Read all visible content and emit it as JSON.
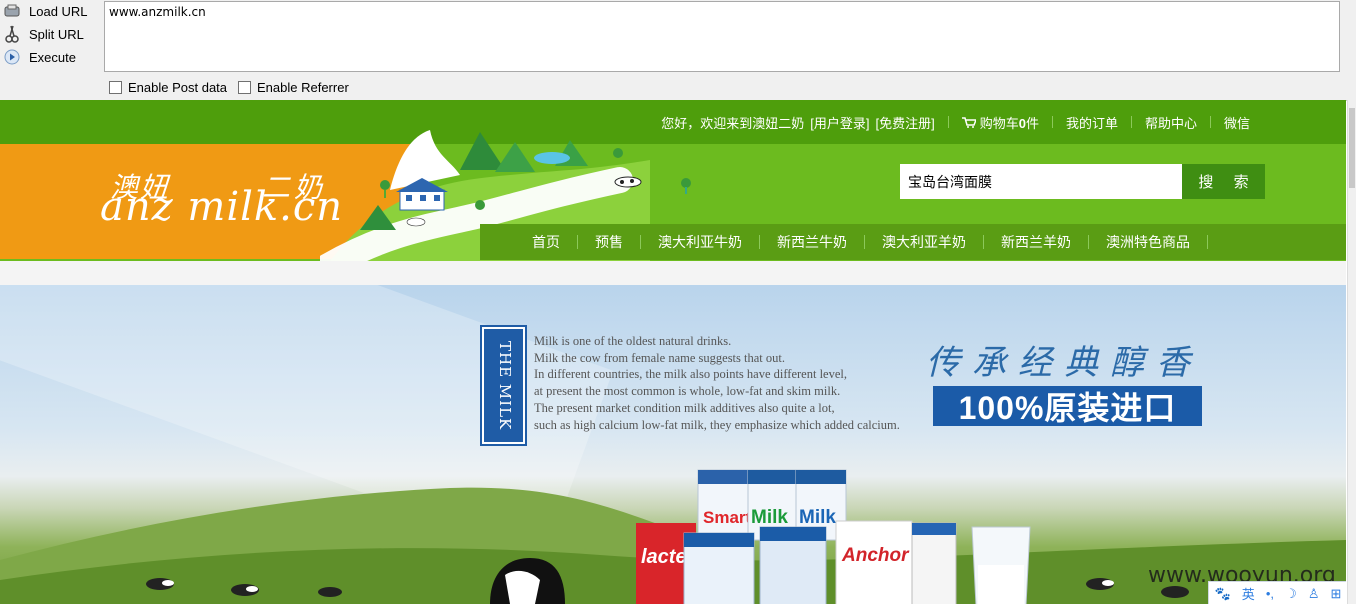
{
  "hackbar": {
    "load_url": "Load URL",
    "split_url": "Split URL",
    "execute": "Execute",
    "url_value": "www.anzmilk.cn",
    "enable_post": "Enable Post data",
    "enable_referrer": "Enable Referrer"
  },
  "site": {
    "topnav": {
      "welcome": "您好，欢迎来到澳妞二奶",
      "login": "[用户登录]",
      "register": "[免费注册]",
      "cart": "购物车",
      "cart_count": "0",
      "cart_unit": "件",
      "orders": "我的订单",
      "help": "帮助中心",
      "wechat": "微信"
    },
    "logo": {
      "cn_left": "澳妞",
      "cn_right": "二奶",
      "en": "anz milk.cn"
    },
    "search": {
      "value": "宝岛台湾面膜",
      "button": "搜 索"
    },
    "mainnav": [
      "首页",
      "预售",
      "澳大利亚牛奶",
      "新西兰牛奶",
      "澳大利亚羊奶",
      "新西兰羊奶",
      "澳洲特色商品"
    ]
  },
  "banner": {
    "badge": "THE MILK",
    "lines": [
      "Milk is one of the oldest natural drinks.",
      "Milk the cow from female name suggests that out.",
      "In different countries, the milk also points have different level,",
      "at present the most common is whole, low-fat and skim milk.",
      "The present market condition milk additives also quite a lot,",
      "such as high calcium low-fat milk, they emphasize which added calcium."
    ],
    "slogan": "传承经典醇香",
    "imported": "100%原装进口",
    "products": [
      "Smart",
      "Milk",
      "Milk",
      "lacte",
      "Anchor"
    ]
  },
  "watermark": "www.wooyun.org",
  "ime": {
    "lang": "英"
  },
  "colors": {
    "green_dark": "#4e9e0c",
    "green": "#6cbb1f",
    "orange": "#f09a14",
    "blue": "#1b5ba8"
  }
}
